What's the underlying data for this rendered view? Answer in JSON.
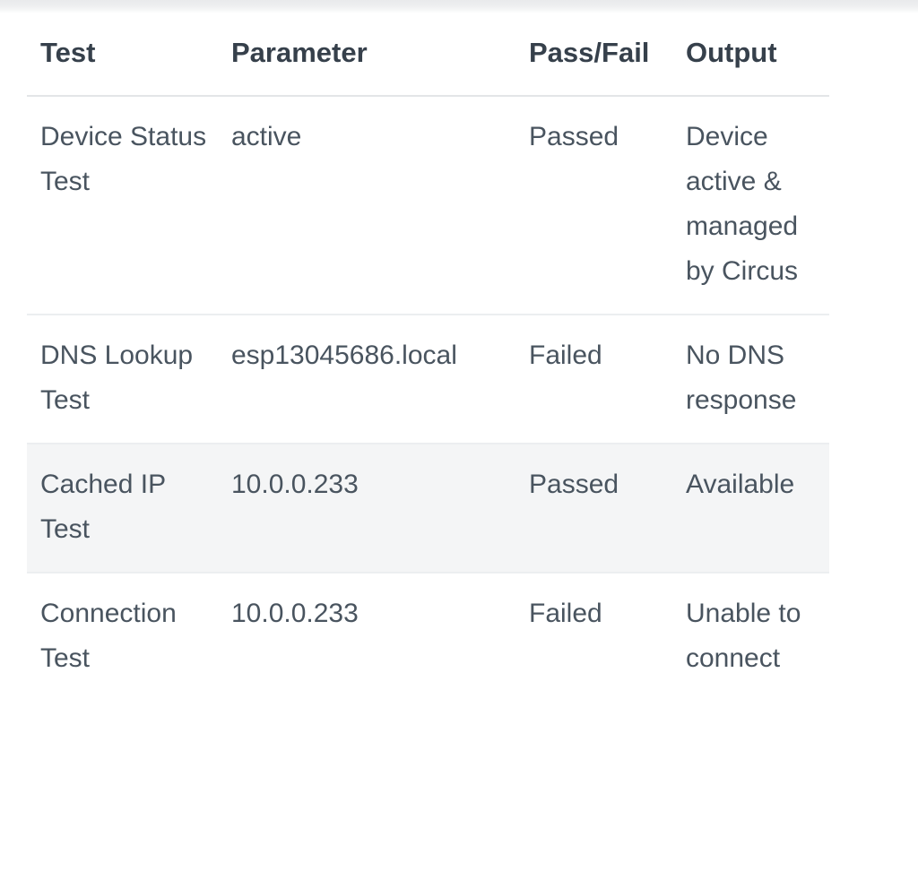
{
  "table": {
    "name": "diagnostic-test-results",
    "columns": [
      {
        "key": "test",
        "label": "Test"
      },
      {
        "key": "parameter",
        "label": "Parameter"
      },
      {
        "key": "passfail",
        "label": "Pass/Fail"
      },
      {
        "key": "output",
        "label": "Output"
      }
    ],
    "rows": [
      {
        "test": "Device Status Test",
        "parameter": "active",
        "passfail": "Passed",
        "output": "Device active & managed by Circus",
        "shaded": false
      },
      {
        "test": "DNS Lookup Test",
        "parameter": "esp13045686.local",
        "passfail": "Failed",
        "output": "No DNS response",
        "shaded": false
      },
      {
        "test": "Cached IP Test",
        "parameter": "10.0.0.233",
        "passfail": "Passed",
        "output": "Available",
        "shaded": true
      },
      {
        "test": "Connection Test",
        "parameter": "10.0.0.233",
        "passfail": "Failed",
        "output": "Unable to connect",
        "shaded": false
      }
    ]
  },
  "colors": {
    "header_text": "#36404b",
    "body_text": "#49545f",
    "header_rule": "#e3e5e7",
    "row_rule": "#eceef0",
    "zebra_row_bg": "#f4f5f6",
    "page_bg": "#ffffff"
  }
}
